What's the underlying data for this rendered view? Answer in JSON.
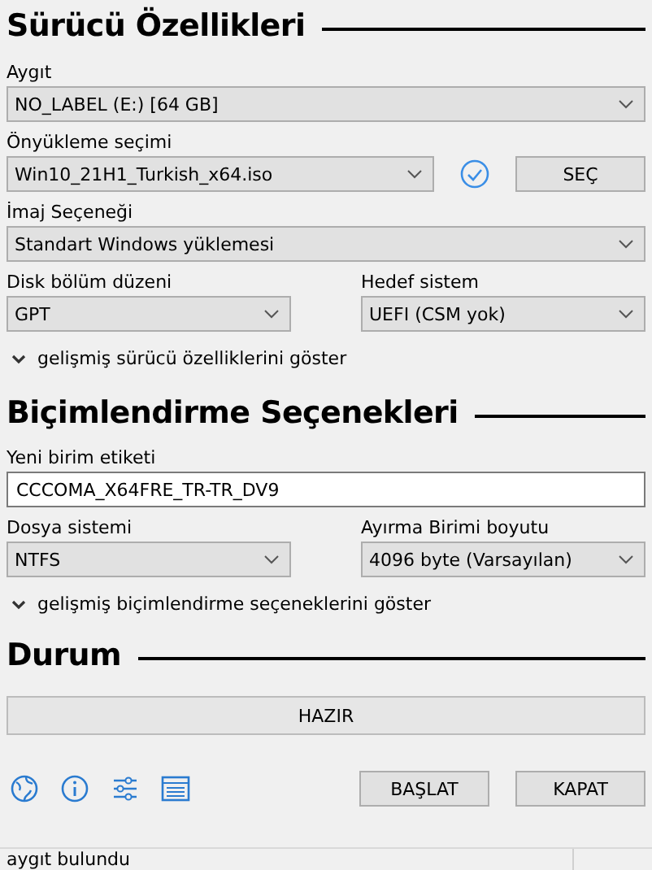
{
  "drive_properties": {
    "heading": "Sürücü Özellikleri",
    "device": {
      "label": "Aygıt",
      "value": "NO_LABEL (E:) [64 GB]"
    },
    "boot_selection": {
      "label": "Önyükleme seçimi",
      "value": "Win10_21H1_Turkish_x64.iso",
      "verified": true,
      "button": "SEÇ"
    },
    "image_option": {
      "label": "İmaj Seçeneği",
      "value": "Standart Windows yüklemesi"
    },
    "partition_scheme": {
      "label": "Disk bölüm düzeni",
      "value": "GPT"
    },
    "target_system": {
      "label": "Hedef sistem",
      "value": "UEFI (CSM yok)"
    },
    "advanced": {
      "label": "gelişmiş sürücü özelliklerini göster",
      "expanded": false
    }
  },
  "format_options": {
    "heading": "Biçimlendirme Seçenekleri",
    "volume_label": {
      "label": "Yeni birim etiketi",
      "value": "CCCOMA_X64FRE_TR-TR_DV9"
    },
    "file_system": {
      "label": "Dosya sistemi",
      "value": "NTFS"
    },
    "cluster_size": {
      "label": "Ayırma Birimi boyutu",
      "value": "4096 byte (Varsayılan)"
    },
    "advanced": {
      "label": "gelişmiş biçimlendirme seçeneklerini göster",
      "expanded": false
    }
  },
  "status": {
    "heading": "Durum",
    "text": "HAZIR"
  },
  "buttons": [
    "BAŞLAT",
    "KAPAT"
  ],
  "status_bar": {
    "text": "aygıt bulundu"
  }
}
